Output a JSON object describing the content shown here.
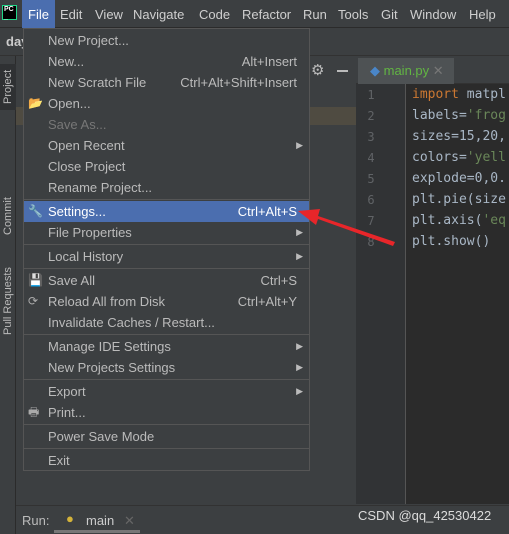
{
  "menubar": {
    "items": [
      "File",
      "Edit",
      "View",
      "Navigate",
      "Code",
      "Refactor",
      "Run",
      "Tools",
      "Git",
      "Window",
      "Help"
    ],
    "active": "File"
  },
  "toolbar": {
    "project_name": "day"
  },
  "side_tabs": [
    "Project",
    "Commit",
    "Pull Requests"
  ],
  "editor": {
    "tab_label": "main.py",
    "lines": [
      "1",
      "2",
      "3",
      "4",
      "5",
      "6",
      "7",
      "8"
    ],
    "code": [
      "import matpl",
      "labels='frog",
      "sizes=15,20,",
      "colors='yell",
      "explode=0,0.",
      "plt.pie(size",
      "plt.axis('eq",
      "plt.show()"
    ]
  },
  "file_menu": {
    "items": [
      {
        "label": "New Project...",
        "shortcut": ""
      },
      {
        "label": "New...",
        "shortcut": "Alt+Insert"
      },
      {
        "label": "New Scratch File",
        "shortcut": "Ctrl+Alt+Shift+Insert"
      },
      {
        "label": "Open...",
        "shortcut": "",
        "icon": "folder-icon"
      },
      {
        "label": "Save As...",
        "shortcut": "",
        "disabled": true
      },
      {
        "label": "Open Recent",
        "shortcut": "",
        "submenu": true
      },
      {
        "label": "Close Project",
        "shortcut": ""
      },
      {
        "label": "Rename Project...",
        "shortcut": ""
      },
      {
        "label": "Settings...",
        "shortcut": "Ctrl+Alt+S",
        "icon": "wrench-icon",
        "highlighted": true
      },
      {
        "label": "File Properties",
        "shortcut": "",
        "submenu": true
      },
      {
        "label": "Local History",
        "shortcut": "",
        "submenu": true
      },
      {
        "label": "Save All",
        "shortcut": "Ctrl+S",
        "icon": "save-icon"
      },
      {
        "label": "Reload All from Disk",
        "shortcut": "Ctrl+Alt+Y",
        "icon": "reload-icon"
      },
      {
        "label": "Invalidate Caches / Restart...",
        "shortcut": ""
      },
      {
        "label": "Manage IDE Settings",
        "shortcut": "",
        "submenu": true
      },
      {
        "label": "New Projects Settings",
        "shortcut": "",
        "submenu": true
      },
      {
        "label": "Export",
        "shortcut": "",
        "submenu": true
      },
      {
        "label": "Print...",
        "shortcut": "",
        "icon": "print-icon"
      },
      {
        "label": "Power Save Mode",
        "shortcut": ""
      },
      {
        "label": "Exit",
        "shortcut": ""
      }
    ]
  },
  "run": {
    "label": "Run:",
    "tab": "main"
  },
  "watermark": "CSDN @qq_42530422",
  "colors": {
    "highlight": "#4b6eaf",
    "arrow": "#e8262a"
  }
}
